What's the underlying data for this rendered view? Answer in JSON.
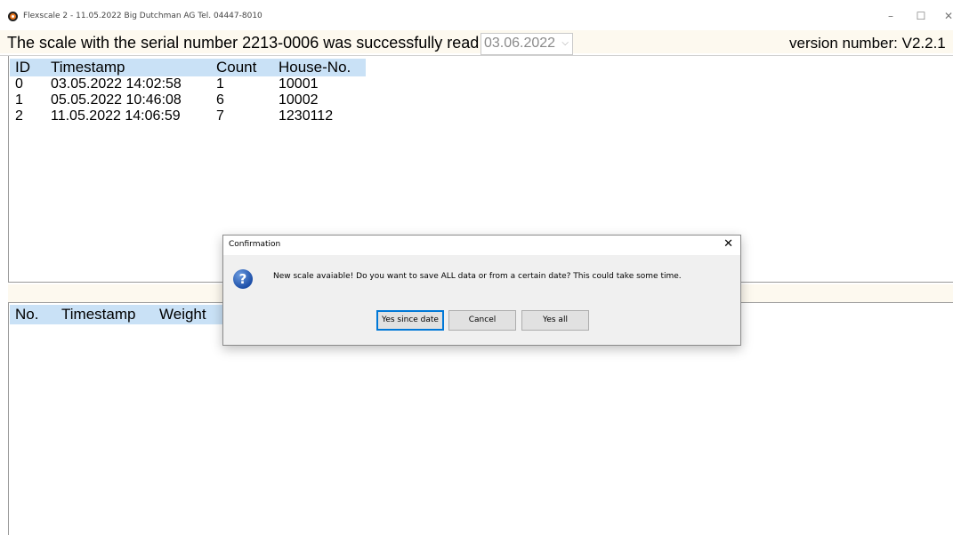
{
  "window": {
    "title": "Flexscale 2 - 11.05.2022 Big Dutchman AG  Tel. 04447-8010",
    "controls": {
      "minimize": "–",
      "maximize": "☐",
      "close": "✕"
    }
  },
  "header": {
    "status": "The scale with the serial number 2213-0006 was successfully read",
    "date_value": "03.06.2022",
    "version": "version number: V2.2.1"
  },
  "top_table": {
    "columns": [
      "ID",
      "Timestamp",
      "Count",
      "House-No."
    ],
    "rows": [
      [
        "0",
        "03.05.2022 14:02:58",
        "1",
        "10001"
      ],
      [
        "1",
        "05.05.2022 10:46:08",
        "6",
        "10002"
      ],
      [
        "2",
        "11.05.2022 14:06:59",
        "7",
        "1230112"
      ]
    ]
  },
  "bottom_table": {
    "columns": [
      "No.",
      "Timestamp",
      "Weight"
    ]
  },
  "dialog": {
    "title": "Confirmation",
    "close": "✕",
    "icon": "question-icon",
    "message": "New scale avaiable! Do you want to save ALL data or from a certain date? This could take some time.",
    "buttons": {
      "yes_since_date": "Yes since date",
      "cancel": "Cancel",
      "yes_all": "Yes all"
    }
  }
}
